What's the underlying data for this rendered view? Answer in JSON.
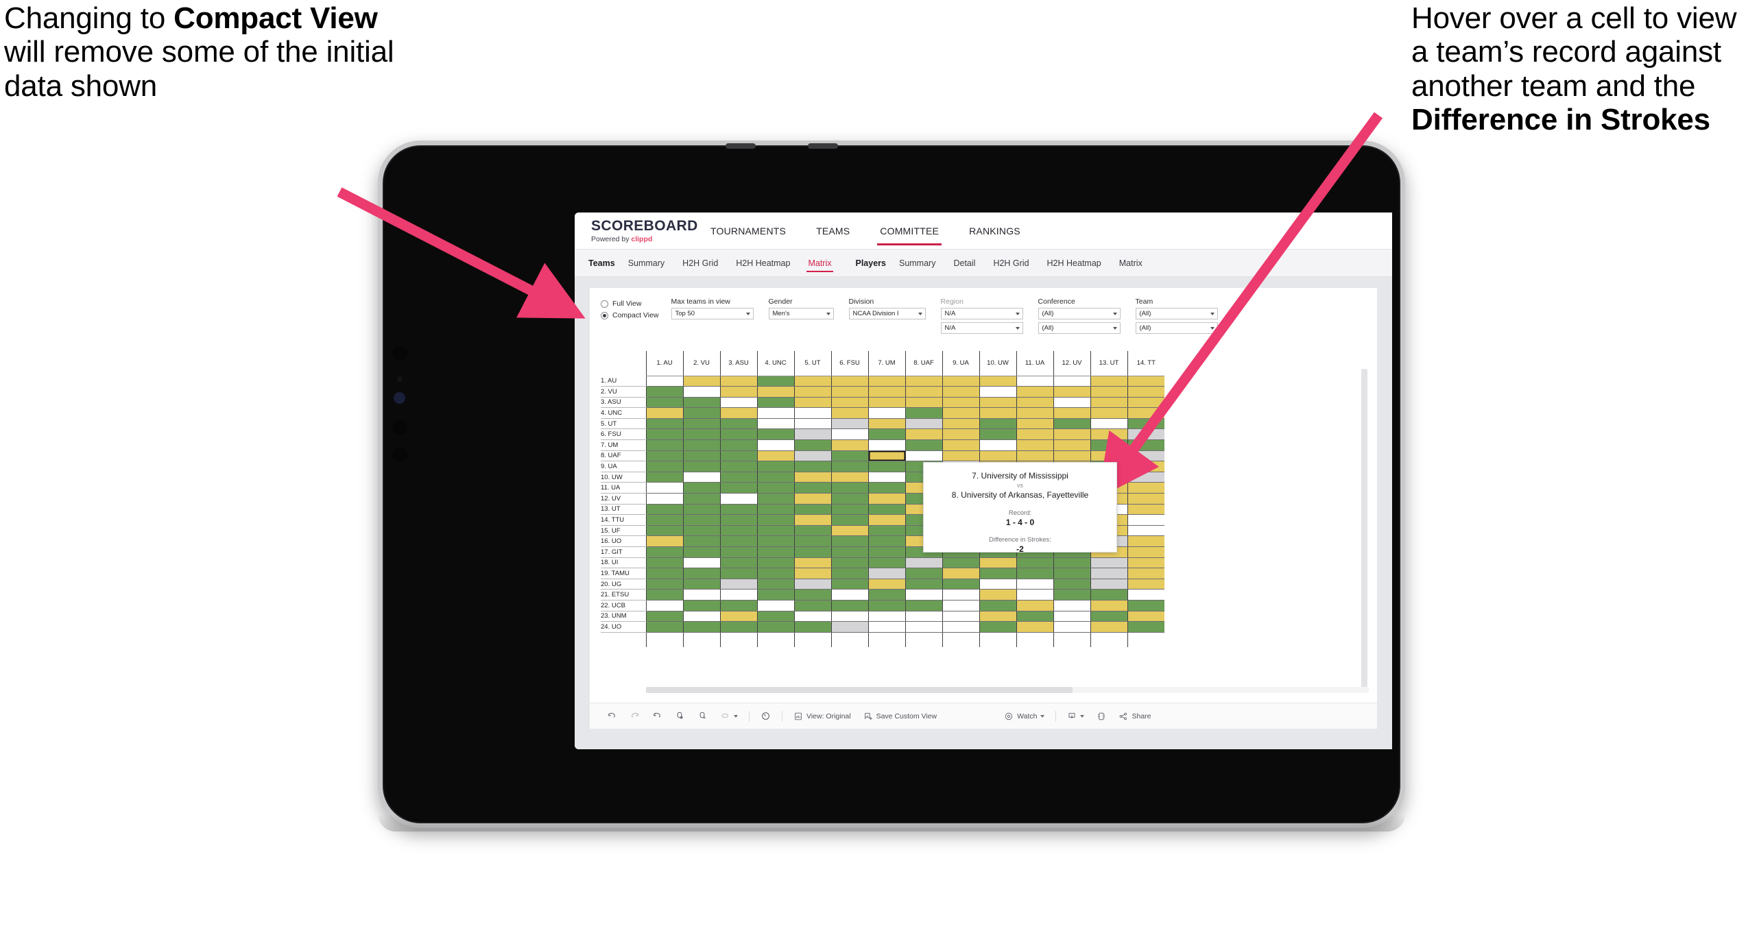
{
  "annotations": {
    "left": {
      "pre": "Changing to ",
      "bold": "Compact View",
      "post": " will remove some of the initial data shown"
    },
    "right": {
      "pre": "Hover over a cell to view a team’s record against another team and the ",
      "bold": "Difference in Strokes",
      "post": ""
    }
  },
  "app": {
    "logo": {
      "title": "SCOREBOARD",
      "powered_prefix": "Powered by ",
      "brand": "clippd"
    },
    "top_nav": [
      {
        "label": "TOURNAMENTS",
        "active": false
      },
      {
        "label": "TEAMS",
        "active": false
      },
      {
        "label": "COMMITTEE",
        "active": true
      },
      {
        "label": "RANKINGS",
        "active": false
      }
    ],
    "sub_tabs": {
      "teams_group_label": "Teams",
      "teams_items": [
        {
          "label": "Summary",
          "active": false
        },
        {
          "label": "H2H Grid",
          "active": false
        },
        {
          "label": "H2H Heatmap",
          "active": false
        },
        {
          "label": "Matrix",
          "active": true
        }
      ],
      "players_group_label": "Players",
      "players_items": [
        {
          "label": "Summary",
          "active": false
        },
        {
          "label": "Detail",
          "active": false
        },
        {
          "label": "H2H Grid",
          "active": false
        },
        {
          "label": "H2H Heatmap",
          "active": false
        },
        {
          "label": "Matrix",
          "active": false
        }
      ]
    },
    "filters": {
      "view_mode": [
        {
          "label": "Full View",
          "selected": false
        },
        {
          "label": "Compact View",
          "selected": true
        }
      ],
      "max_teams": {
        "label": "Max teams in view",
        "value": "Top 50"
      },
      "gender": {
        "label": "Gender",
        "value": "Men's"
      },
      "division": {
        "label": "Division",
        "value": "NCAA Division I"
      },
      "region": {
        "label": "Region",
        "value": "N/A",
        "value2": "N/A"
      },
      "conference": {
        "label": "Conference",
        "value": "(All)",
        "value2": "(All)"
      },
      "team": {
        "label": "Team",
        "value": "(All)",
        "value2": "(All)"
      }
    },
    "tooltip": {
      "team_a": "7. University of Mississippi",
      "vs": "vs",
      "team_b": "8. University of Arkansas, Fayetteville",
      "record_label": "Record:",
      "record_value": "1 - 4 - 0",
      "strokes_label": "Difference in Strokes:",
      "strokes_value": "-2"
    },
    "toolbar": {
      "view_label": "View: Original",
      "save_label": "Save Custom View",
      "watch_label": "Watch",
      "share_label": "Share"
    }
  },
  "chart_data": {
    "type": "heatmap",
    "title": "Teams Head-to-Head Matrix",
    "legend": {
      "win": "#6b9e55",
      "loss": "#e6cb5e",
      "none": "#ffffff",
      "tie": "#d4d4d6"
    },
    "columns": [
      "1. AU",
      "2. VU",
      "3. ASU",
      "4. UNC",
      "5. UT",
      "6. FSU",
      "7. UM",
      "8. UAF",
      "9. UA",
      "10. UW",
      "11. UA",
      "12. UV",
      "13. UT",
      "14. TT"
    ],
    "rows": [
      "1. AU",
      "2. VU",
      "3. ASU",
      "4. UNC",
      "5. UT",
      "6. FSU",
      "7. UM",
      "8. UAF",
      "9. UA",
      "10. UW",
      "11. UA",
      "12. UV",
      "13. UT",
      "14. TTU",
      "15. UF",
      "16. UO",
      "17. GIT",
      "18. UI",
      "19. TAMU",
      "20. UG",
      "21. ETSU",
      "22. UCB",
      "23. UNM",
      "24. UO"
    ],
    "cells": [
      [
        "w",
        "y",
        "y",
        "g",
        "y",
        "y",
        "y",
        "y",
        "y",
        "y",
        "w",
        "w",
        "y",
        "y"
      ],
      [
        "g",
        "w",
        "y",
        "y",
        "y",
        "y",
        "y",
        "y",
        "y",
        "w",
        "y",
        "y",
        "y",
        "y"
      ],
      [
        "g",
        "g",
        "w",
        "g",
        "y",
        "y",
        "y",
        "y",
        "y",
        "y",
        "y",
        "w",
        "y",
        "y"
      ],
      [
        "y",
        "g",
        "y",
        "w",
        "w",
        "y",
        "w",
        "g",
        "y",
        "y",
        "y",
        "y",
        "y",
        "y"
      ],
      [
        "g",
        "g",
        "g",
        "w",
        "w",
        "s",
        "y",
        "s",
        "y",
        "g",
        "y",
        "g",
        "w",
        "g"
      ],
      [
        "g",
        "g",
        "g",
        "g",
        "s",
        "w",
        "g",
        "y",
        "y",
        "g",
        "y",
        "y",
        "y",
        "s"
      ],
      [
        "g",
        "g",
        "g",
        "w",
        "g",
        "y",
        "w",
        "g",
        "y",
        "w",
        "y",
        "y",
        "g",
        "g"
      ],
      [
        "g",
        "g",
        "g",
        "y",
        "s",
        "g",
        "y",
        "w",
        "y",
        "y",
        "y",
        "y",
        "y",
        "s"
      ],
      [
        "g",
        "g",
        "g",
        "g",
        "g",
        "g",
        "g",
        "g",
        "w",
        "y",
        "y",
        "y",
        "g",
        "y"
      ],
      [
        "g",
        "w",
        "g",
        "g",
        "y",
        "y",
        "w",
        "g",
        "g",
        "w",
        "w",
        "g",
        "y",
        "s"
      ],
      [
        "w",
        "g",
        "g",
        "g",
        "g",
        "g",
        "g",
        "y",
        "g",
        "w",
        "w",
        "y",
        "y",
        "y"
      ],
      [
        "w",
        "g",
        "w",
        "g",
        "y",
        "g",
        "y",
        "g",
        "g",
        "w",
        "w",
        "w",
        "y",
        "y"
      ],
      [
        "g",
        "g",
        "g",
        "g",
        "g",
        "g",
        "g",
        "y",
        "g",
        "g",
        "y",
        "y",
        "w",
        "y"
      ],
      [
        "g",
        "g",
        "g",
        "g",
        "y",
        "g",
        "y",
        "g",
        "y",
        "y",
        "s",
        "g",
        "y",
        "w"
      ],
      [
        "g",
        "g",
        "g",
        "g",
        "g",
        "y",
        "g",
        "g",
        "y",
        "w",
        "y",
        "g",
        "y",
        "w"
      ],
      [
        "y",
        "g",
        "g",
        "g",
        "g",
        "g",
        "g",
        "y",
        "g",
        "g",
        "w",
        "g",
        "s",
        "y"
      ],
      [
        "g",
        "g",
        "g",
        "g",
        "g",
        "g",
        "g",
        "g",
        "g",
        "g",
        "g",
        "g",
        "y",
        "y"
      ],
      [
        "g",
        "w",
        "g",
        "g",
        "y",
        "g",
        "g",
        "s",
        "g",
        "y",
        "g",
        "g",
        "s",
        "y"
      ],
      [
        "g",
        "g",
        "g",
        "g",
        "y",
        "g",
        "s",
        "g",
        "y",
        "g",
        "g",
        "g",
        "s",
        "y"
      ],
      [
        "g",
        "g",
        "s",
        "g",
        "s",
        "g",
        "y",
        "g",
        "g",
        "w",
        "w",
        "g",
        "s",
        "y"
      ],
      [
        "g",
        "w",
        "w",
        "g",
        "g",
        "w",
        "g",
        "w",
        "w",
        "y",
        "w",
        "g",
        "g",
        "w"
      ],
      [
        "w",
        "g",
        "g",
        "w",
        "g",
        "g",
        "g",
        "g",
        "w",
        "g",
        "y",
        "w",
        "y",
        "g"
      ],
      [
        "g",
        "w",
        "y",
        "g",
        "w",
        "w",
        "w",
        "w",
        "w",
        "y",
        "g",
        "w",
        "g",
        "y"
      ],
      [
        "g",
        "g",
        "g",
        "g",
        "g",
        "s",
        "w",
        "w",
        "w",
        "g",
        "y",
        "w",
        "y",
        "g"
      ]
    ]
  }
}
